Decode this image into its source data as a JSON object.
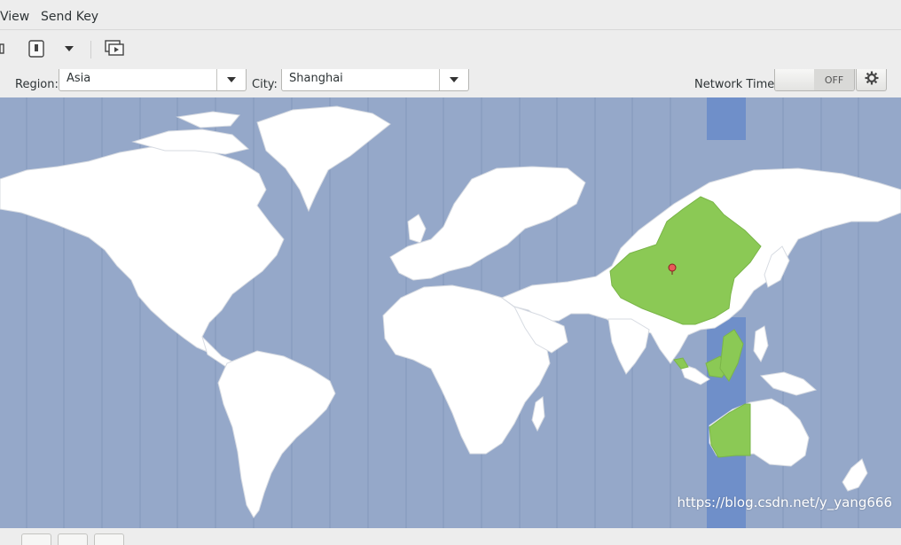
{
  "menubar": {
    "view": "View",
    "send_key": "Send Key"
  },
  "toolbar": {
    "items": [
      {
        "name": "power-icon"
      },
      {
        "name": "usb-icon"
      },
      {
        "name": "chevron-down-icon"
      },
      {
        "name": "screens-icon"
      }
    ]
  },
  "timezone": {
    "region_label": "Region:",
    "region_value": "Asia",
    "city_label": "City:",
    "city_value": "Shanghai",
    "network_time_label": "Network Time",
    "network_time_state": "OFF"
  },
  "map": {
    "ocean_color": "#95a8c9",
    "highlight_band_color": "#6f8fc9",
    "land_color": "#ffffff",
    "selected_zone_color": "#8bc955",
    "marker_color": "#e85a5a"
  },
  "watermark": "https://blog.csdn.net/y_yang666"
}
